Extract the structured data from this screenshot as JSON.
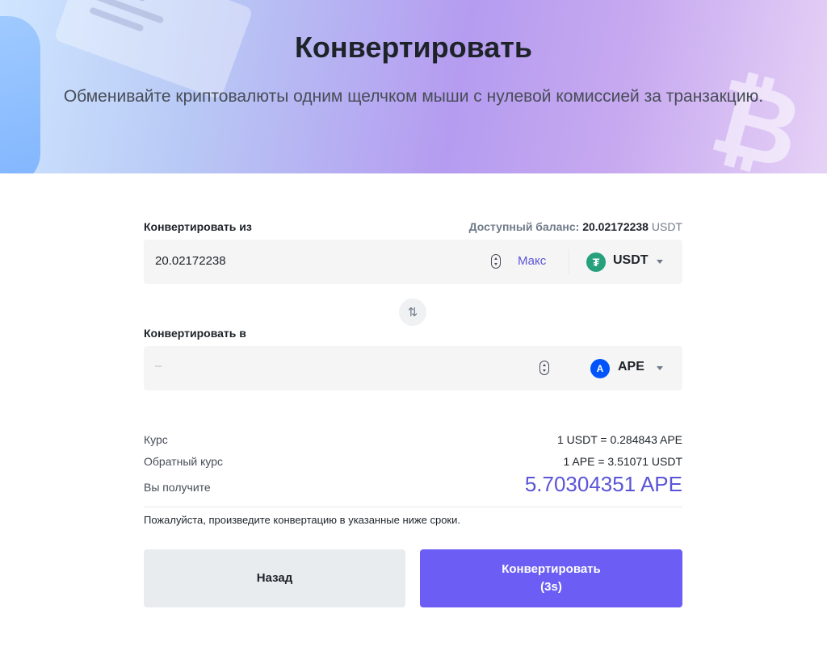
{
  "hero": {
    "title": "Конвертировать",
    "subtitle": "Обменивайте криптовалюты одним щелчком мыши с нулевой комиссией за транзакцию."
  },
  "from": {
    "label": "Конвертировать из",
    "balance_label": "Доступный баланс:",
    "balance_value": "20.02172238",
    "balance_unit": "USDT",
    "amount": "20.02172238",
    "max_label": "Макс",
    "coin": "USDT",
    "coin_icon": "tether-icon",
    "coin_color": "#26a17b"
  },
  "to": {
    "label": "Конвертировать в",
    "placeholder": "–",
    "coin": "APE",
    "coin_icon": "apecoin-icon",
    "coin_color": "#0054f9"
  },
  "info": {
    "rate_label": "Курс",
    "rate_value": "1 USDT = 0.284843 APE",
    "inverse_label": "Обратный курс",
    "inverse_value": "1 APE = 3.51071 USDT",
    "receive_label": "Вы получите",
    "receive_value": "5.70304351 APE"
  },
  "note": "Пожалуйста, произведите конвертацию в указанные ниже сроки.",
  "buttons": {
    "back": "Назад",
    "convert": "Конвертировать",
    "countdown": "(3s)"
  },
  "colors": {
    "accent": "#6c5ef5",
    "link": "#5a55d6"
  }
}
